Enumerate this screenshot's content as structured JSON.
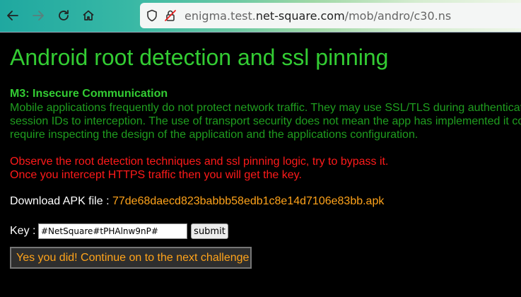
{
  "browser": {
    "url_host_prefix": "enigma.test.",
    "url_host_main": "net-square.com",
    "url_path": "/mob/andro/c30.ns",
    "icons": {
      "back": "back-arrow-icon",
      "forward": "forward-arrow-icon",
      "reload": "reload-icon",
      "home": "home-icon",
      "shield": "shield-icon",
      "insecure": "insecure-lock-icon"
    }
  },
  "page": {
    "title": "Android root detection and ssl pinning",
    "section_title": "M3: Insecure Communication",
    "description_lines": [
      "Mobile applications frequently do not protect network traffic. They may use SSL/TLS during authenticati",
      "session IDs to interception. The use of transport security does not mean the app has implemented it co",
      "require inspecting the design of the application and the applications configuration."
    ],
    "instruction_lines": [
      "Observe the root detection techniques and ssl pinning logic, try to bypass it.",
      "Once you intercept HTTPS traffic then you will get the key."
    ],
    "download_label": "Download APK file : ",
    "download_link": "77de68daecd823babbb58edb1c8e14d7106e83bb.apk",
    "key_label": "Key : ",
    "key_value": "#NetSquare#tPHAlnw9nP#",
    "submit_label": "submit",
    "success_message": "Yes you did! Continue on to the next challenge"
  },
  "colors": {
    "background": "#000000",
    "title": "#33cc33",
    "description": "#1f9e1f",
    "instructions": "#ff1a1a",
    "link": "#ffa31a"
  }
}
